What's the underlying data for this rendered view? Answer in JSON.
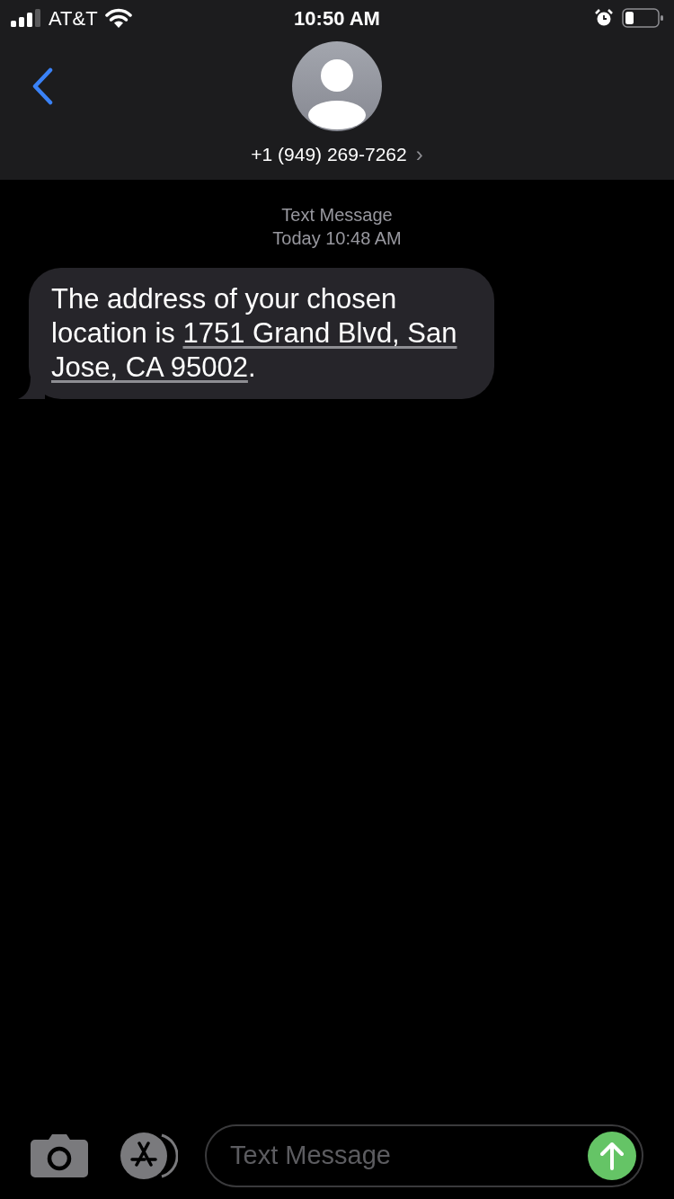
{
  "status_bar": {
    "carrier": "AT&T",
    "time": "10:50 AM"
  },
  "header": {
    "contact": "+1 (949) 269-7262",
    "chevron": "›"
  },
  "thread": {
    "service": "Text Message",
    "timestamp": "Today 10:48 AM",
    "messages": [
      {
        "segments": [
          {
            "kind": "text",
            "text": "The address of your chosen location is "
          },
          {
            "kind": "link",
            "text": "1751 Grand Blvd, San"
          },
          {
            "kind": "link",
            "text": "Jose, CA 95002"
          },
          {
            "kind": "text",
            "text": "."
          }
        ]
      }
    ]
  },
  "composer": {
    "placeholder": "Text Message"
  }
}
